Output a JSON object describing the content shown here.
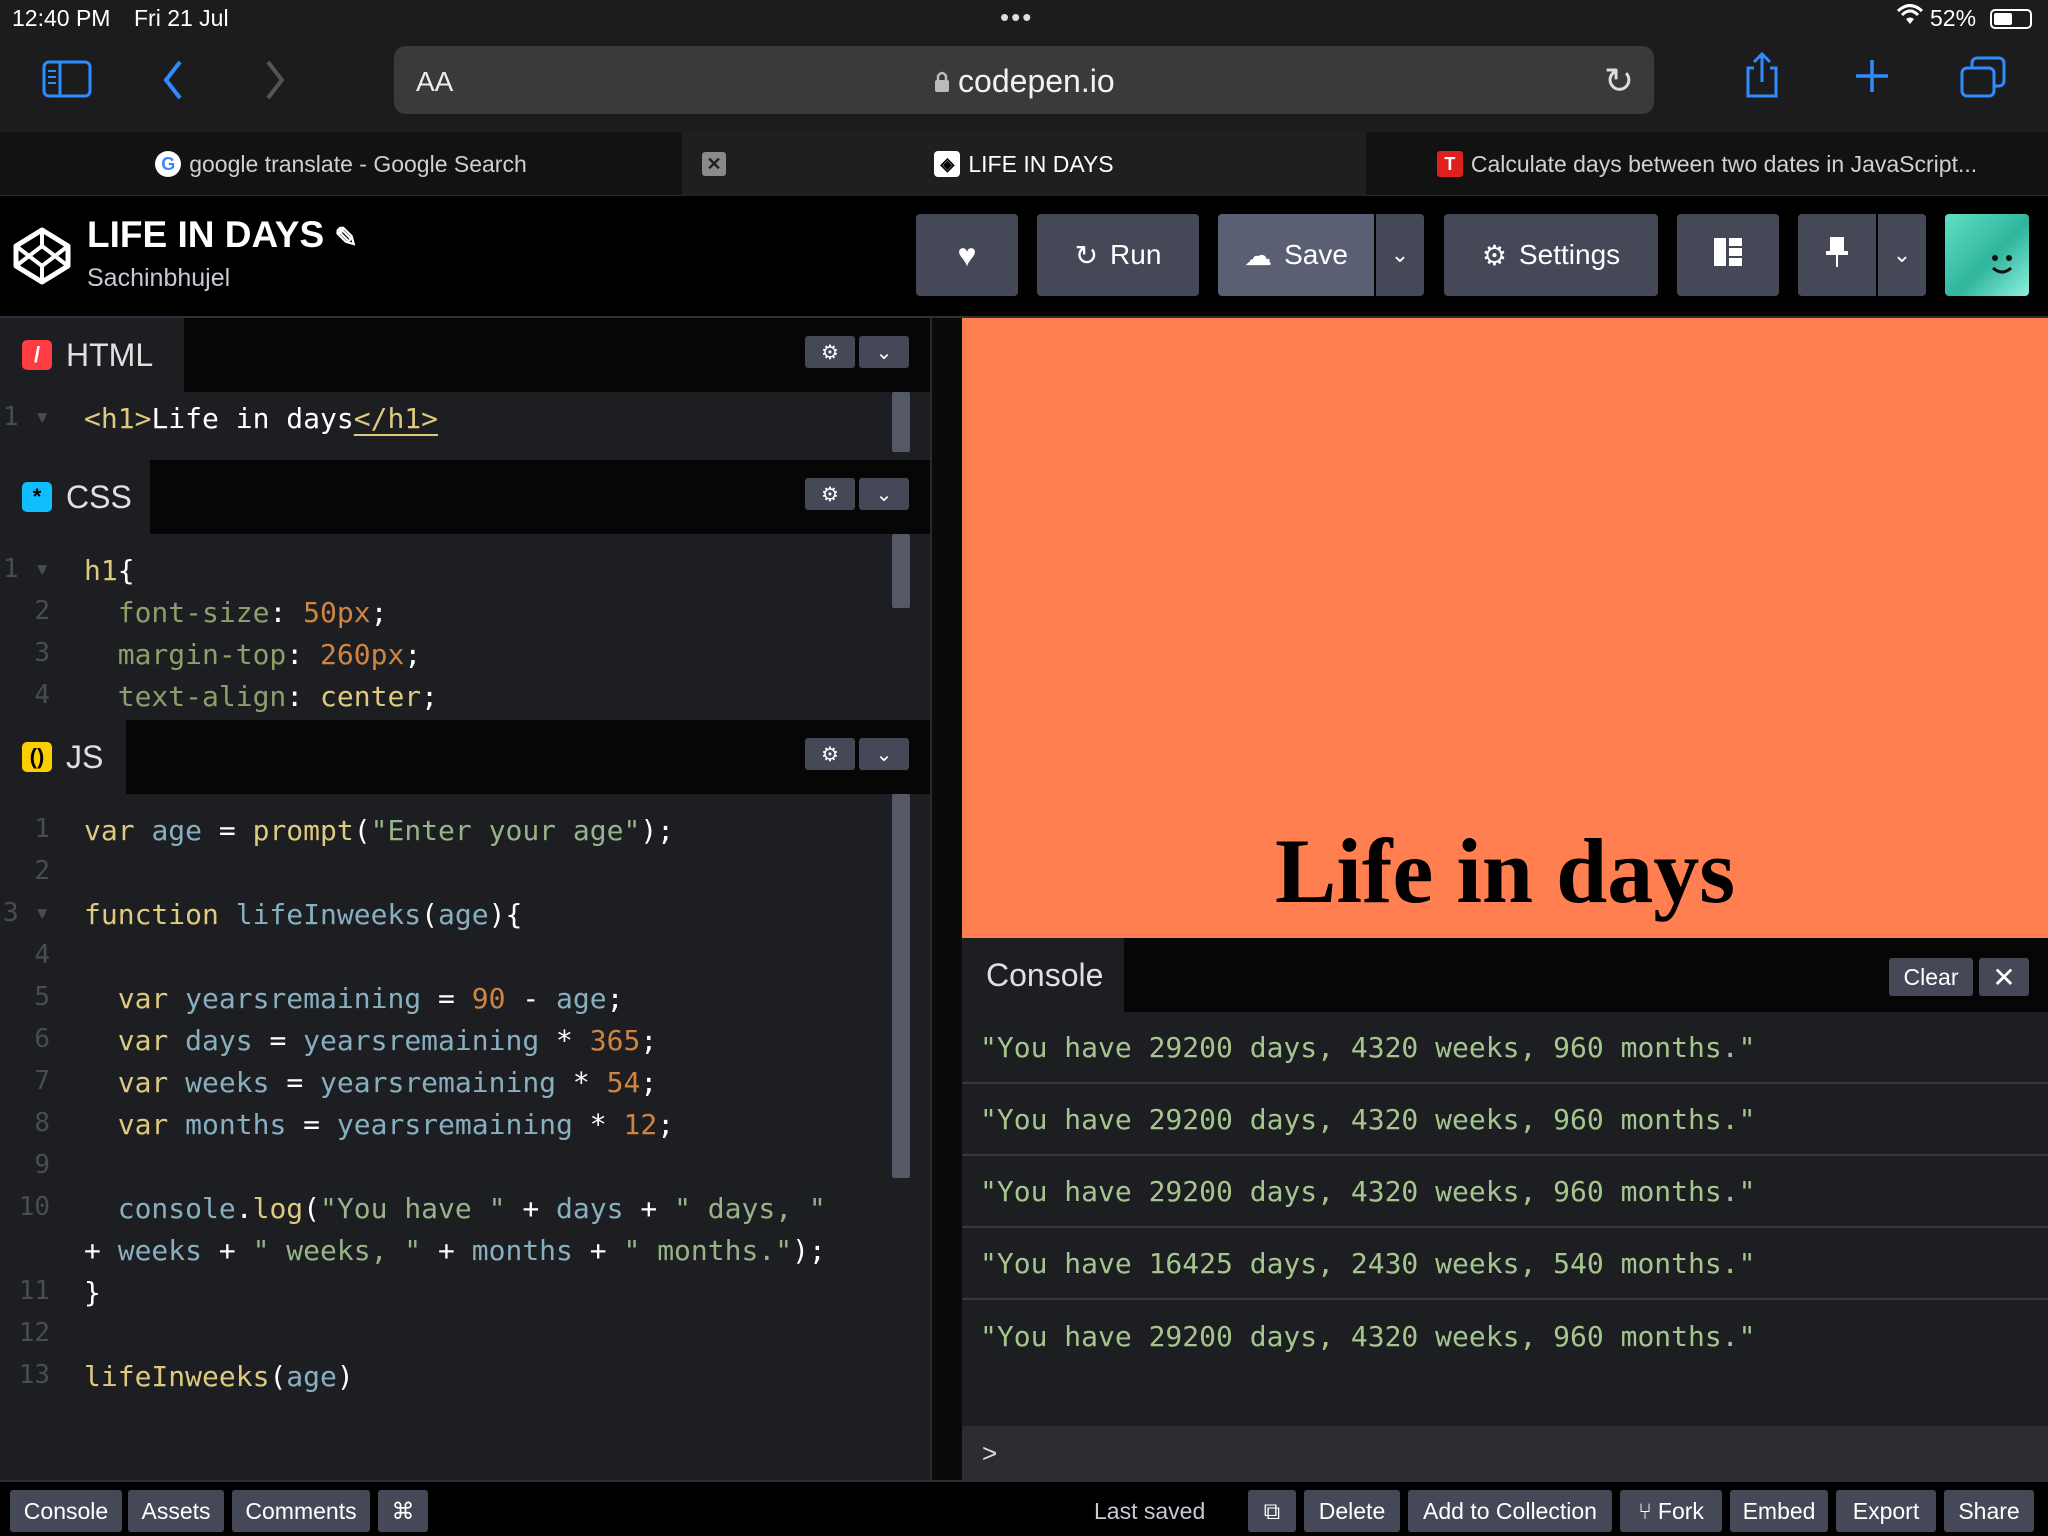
{
  "status": {
    "time": "12:40 PM",
    "date": "Fri 21 Jul",
    "battery": "52%"
  },
  "browser": {
    "url_prefix": "AA",
    "url": "codepen.io",
    "tabs": [
      {
        "title": "google translate - Google Search"
      },
      {
        "title": "LIFE IN DAYS"
      },
      {
        "title": "Calculate days between two dates in JavaScript..."
      }
    ]
  },
  "pen": {
    "title": "LIFE IN DAYS",
    "author": "Sachinbhujel",
    "buttons": {
      "run": "Run",
      "save": "Save",
      "settings": "Settings"
    }
  },
  "editors": {
    "html": {
      "label": "HTML"
    },
    "css": {
      "label": "CSS"
    },
    "js": {
      "label": "JS"
    }
  },
  "preview": {
    "heading": "Life in days",
    "background": "#ff7f50"
  },
  "console": {
    "label": "Console",
    "clear": "Clear",
    "prompt": ">",
    "logs": [
      "\"You have 29200 days, 4320 weeks, 960 months.\"",
      "\"You have 29200 days, 4320 weeks, 960 months.\"",
      "\"You have 29200 days, 4320 weeks, 960 months.\"",
      "\"You have 16425 days, 2430 weeks, 540 months.\"",
      "\"You have 29200 days, 4320 weeks, 960 months.\""
    ]
  },
  "footer": {
    "left": [
      "Console",
      "Assets",
      "Comments",
      "⌘"
    ],
    "last_saved": "Last saved",
    "right": [
      "Delete",
      "Add to Collection",
      "Fork",
      "Embed",
      "Export",
      "Share"
    ]
  },
  "colors": {
    "accent": "#2f8cff",
    "codepen_button": "#444857",
    "save_button": "#5a5f73"
  }
}
